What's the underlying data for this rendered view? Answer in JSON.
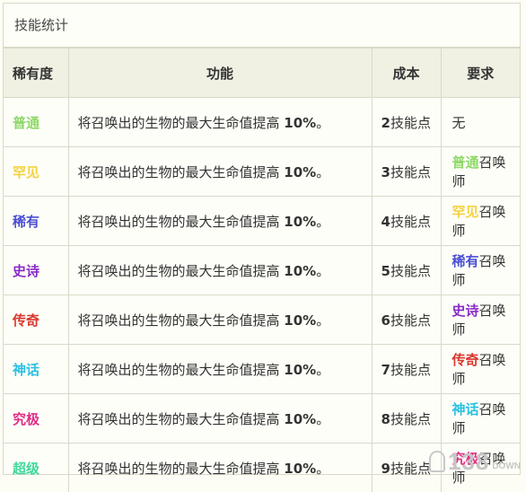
{
  "caption": "技能统计",
  "headers": {
    "rarity": "稀有度",
    "function": "功能",
    "cost": "成本",
    "requirement": "要求"
  },
  "colors": {
    "普通": "#8fd86a",
    "罕见": "#f3d341",
    "稀有": "#4b4fd2",
    "史诗": "#8a2bc9",
    "传奇": "#d9382f",
    "神话": "#2cc0e2",
    "究极": "#e02c85",
    "超级": "#3fd89a"
  },
  "rows": [
    {
      "rarity": "普通",
      "func_text": "将召唤出的生物的最大生命值提高 ",
      "func_bold": "10%",
      "func_end": "。",
      "cost_num": "2",
      "cost_unit": "技能点",
      "req_rarity": "",
      "req_text": "无"
    },
    {
      "rarity": "罕见",
      "func_text": "将召唤出的生物的最大生命值提高 ",
      "func_bold": "10%",
      "func_end": "。",
      "cost_num": "3",
      "cost_unit": "技能点",
      "req_rarity": "普通",
      "req_text": "召唤师"
    },
    {
      "rarity": "稀有",
      "func_text": "将召唤出的生物的最大生命值提高 ",
      "func_bold": "10%",
      "func_end": "。",
      "cost_num": "4",
      "cost_unit": "技能点",
      "req_rarity": "罕见",
      "req_text": "召唤师"
    },
    {
      "rarity": "史诗",
      "func_text": "将召唤出的生物的最大生命值提高 ",
      "func_bold": "10%",
      "func_end": "。",
      "cost_num": "5",
      "cost_unit": "技能点",
      "req_rarity": "稀有",
      "req_text": "召唤师"
    },
    {
      "rarity": "传奇",
      "func_text": "将召唤出的生物的最大生命值提高 ",
      "func_bold": "10%",
      "func_end": "。",
      "cost_num": "6",
      "cost_unit": "技能点",
      "req_rarity": "史诗",
      "req_text": "召唤师"
    },
    {
      "rarity": "神话",
      "func_text": "将召唤出的生物的最大生命值提高 ",
      "func_bold": "10%",
      "func_end": "。",
      "cost_num": "7",
      "cost_unit": "技能点",
      "req_rarity": "传奇",
      "req_text": "召唤师"
    },
    {
      "rarity": "究极",
      "func_text": "将召唤出的生物的最大生命值提高 ",
      "func_bold": "10%",
      "func_end": "。",
      "cost_num": "8",
      "cost_unit": "技能点",
      "req_rarity": "神话",
      "req_text": "召唤师"
    },
    {
      "rarity": "超级",
      "func_text": "将召唤出的生物的最大生命值提高 ",
      "func_bold": "10%",
      "func_end": "。",
      "cost_num": "9",
      "cost_unit": "技能点",
      "req_rarity": "究极",
      "req_text": "召唤师"
    }
  ],
  "watermark": {
    "main": "138",
    "sub": "DOWN"
  }
}
